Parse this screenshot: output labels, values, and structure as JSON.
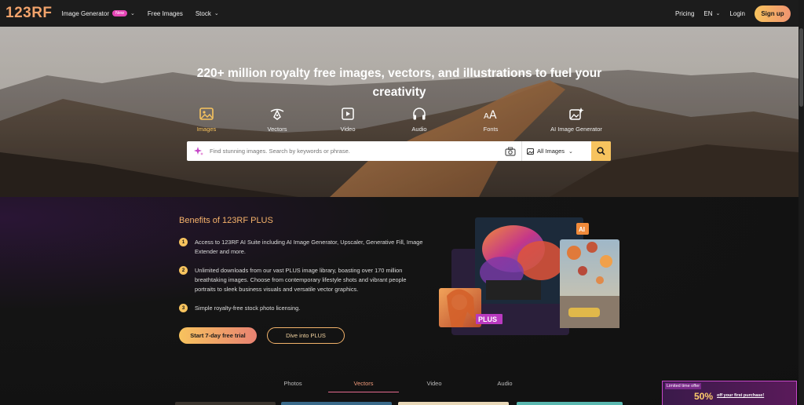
{
  "nav": {
    "logo": "123RF",
    "image_generator": "Image Generator",
    "new_badge": "New",
    "free_images": "Free Images",
    "stock": "Stock",
    "pricing": "Pricing",
    "language": "EN",
    "login": "Login",
    "signup": "Sign up"
  },
  "hero": {
    "title_line1": "220+ million royalty free images, vectors, and illustrations to fuel your",
    "title_line2": "creativity",
    "categories": [
      "Images",
      "Vectors",
      "Video",
      "Audio",
      "Fonts",
      "AI Image Generator"
    ],
    "active_category": "Images",
    "search": {
      "placeholder": "Find stunning images. Search by keywords or phrase.",
      "value": "",
      "filter": "All Images"
    }
  },
  "benefits": {
    "title": "Benefits of 123RF PLUS",
    "items": [
      {
        "n": "1",
        "text": "Access to 123RF AI Suite including AI Image Generator, Upscaler, Generative Fill, Image Extender and more."
      },
      {
        "n": "2",
        "text": "Unlimited downloads from our vast PLUS image library, boasting over 170 million breathtaking images. Choose from contemporary lifestyle shots and vibrant people portraits to sleek business visuals and versatile vector graphics."
      },
      {
        "n": "3",
        "text": "Simple royalty-free stock photo licensing."
      }
    ],
    "trial_button": "Start 7-day free trial",
    "dive_button": "Dive into PLUS",
    "ai_badge": "AI",
    "plus_badge": "PLUS"
  },
  "tabs": {
    "items": [
      "Photos",
      "Vectors",
      "Video",
      "Audio"
    ],
    "active": "Vectors"
  },
  "offer": {
    "label": "Limited time offer",
    "percent": "50%",
    "text": "off your first purchase!"
  },
  "colors": {
    "accent": "#f7c35e",
    "accent2": "#f09370",
    "pink": "#e646b6",
    "nav_bg": "#1c1c1c",
    "page_bg": "#121212"
  }
}
